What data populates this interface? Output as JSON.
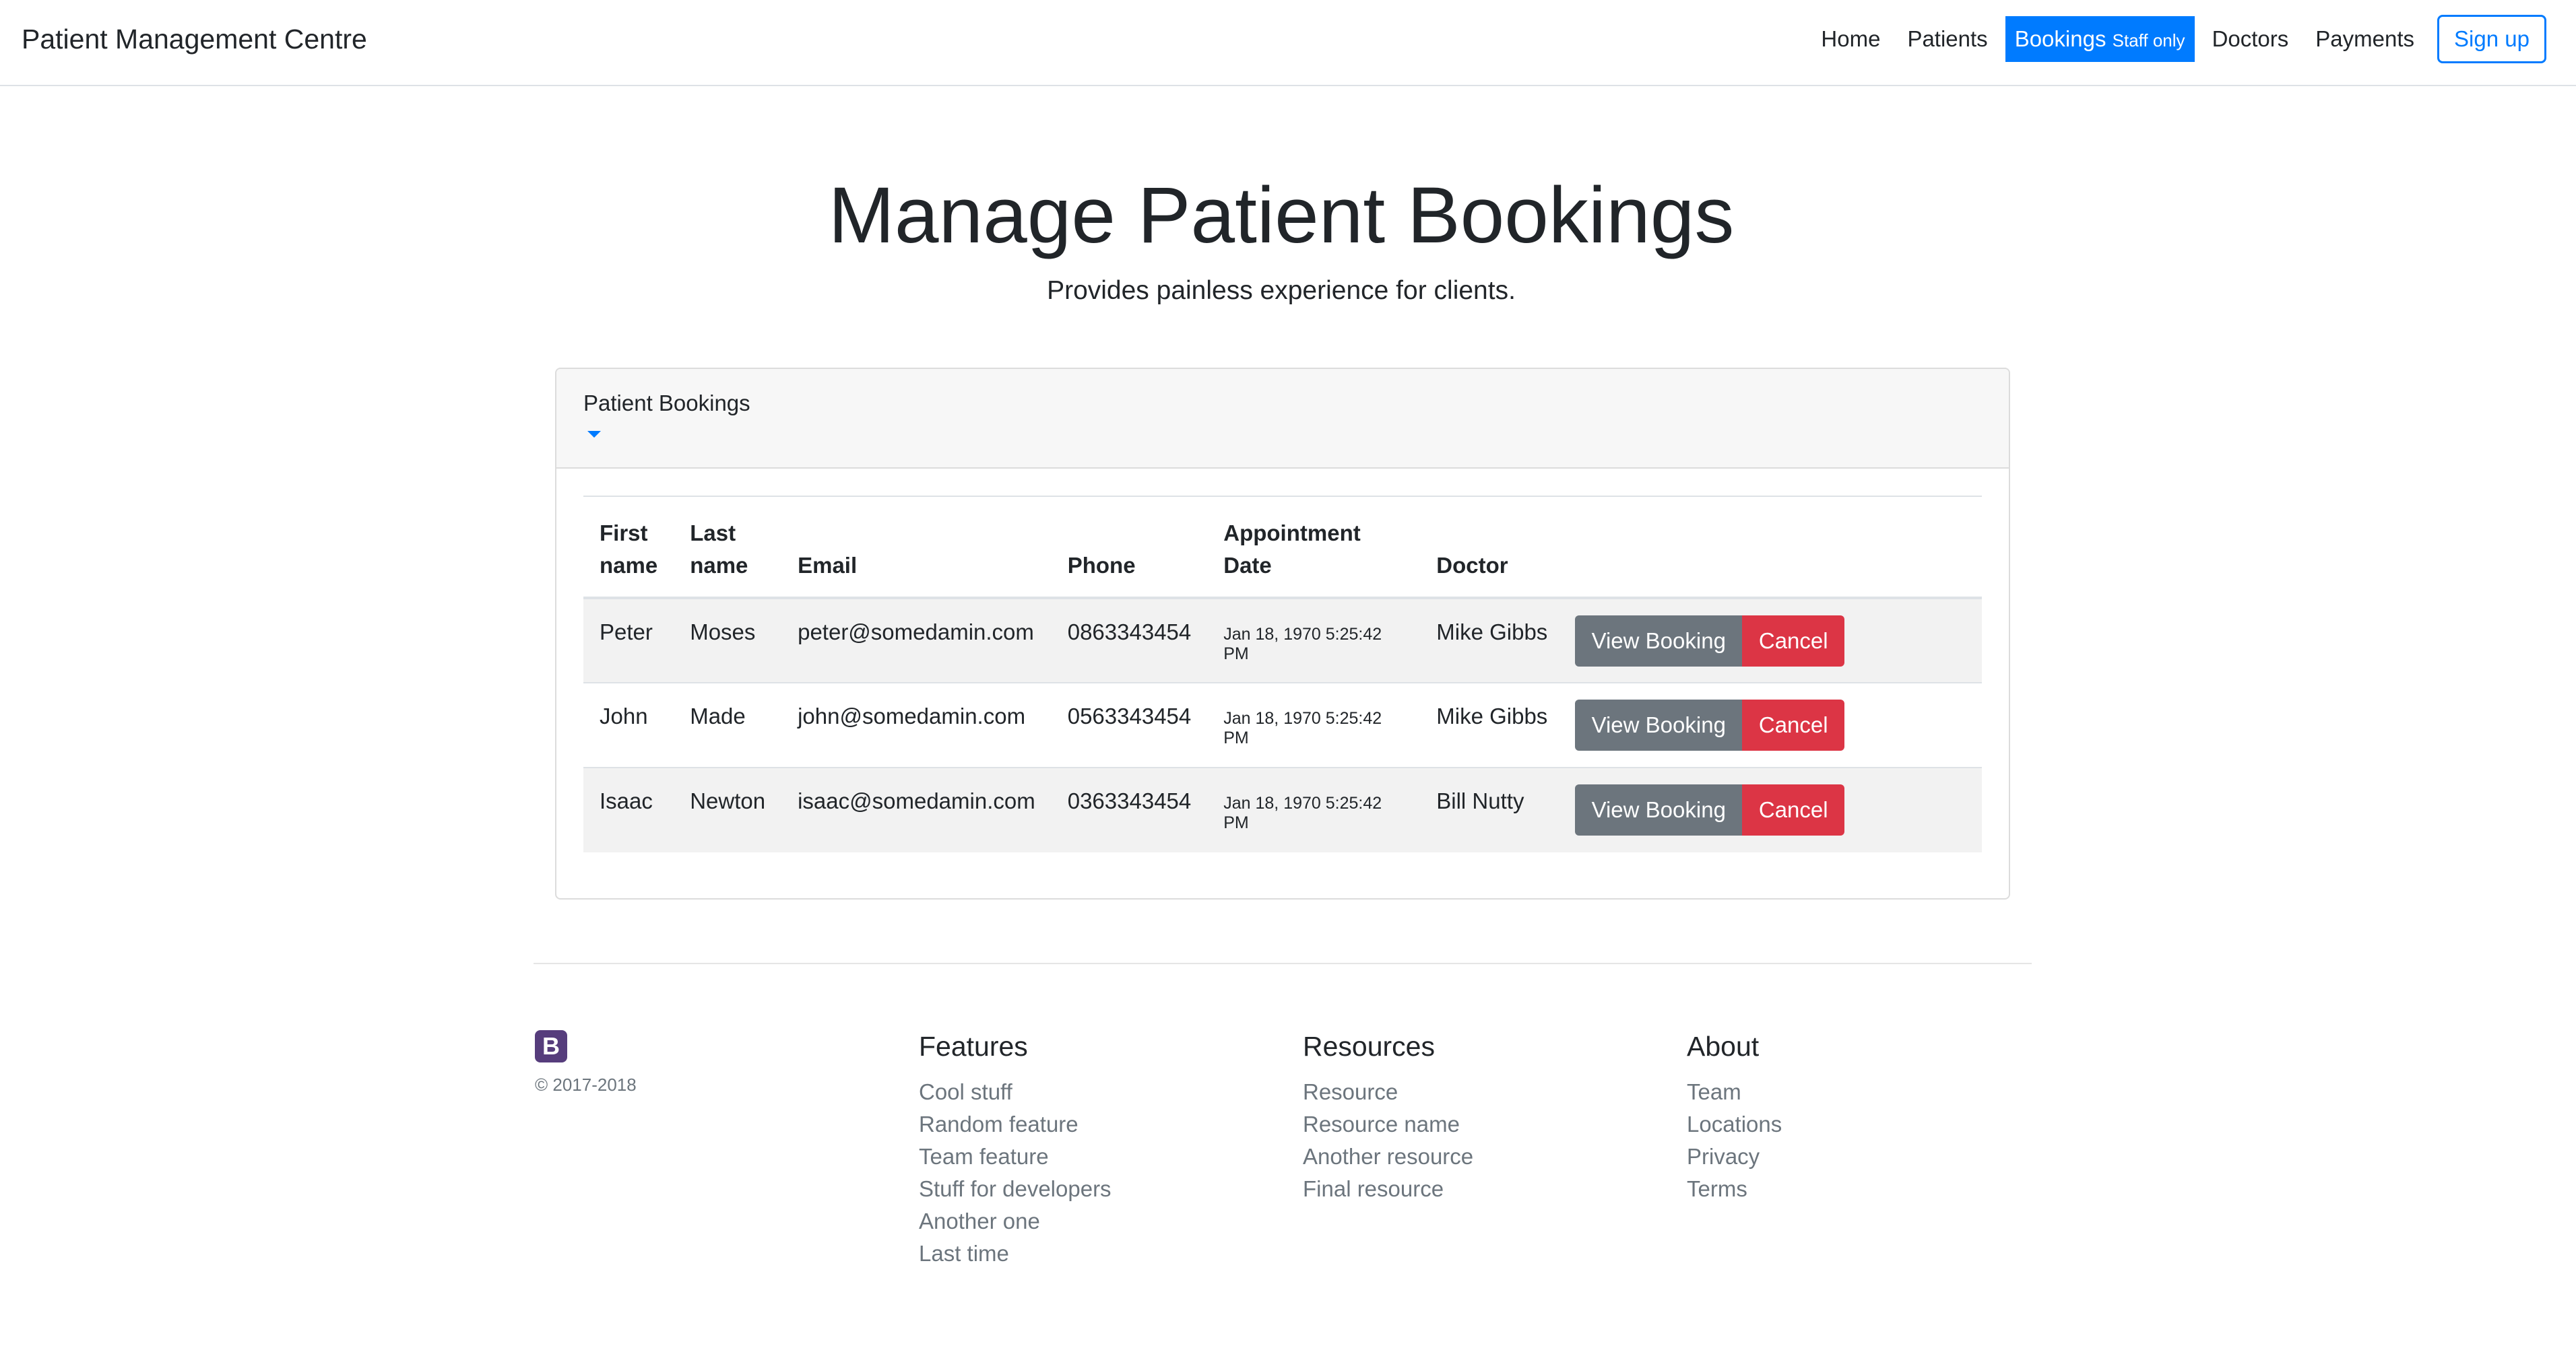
{
  "navbar": {
    "brand": "Patient Management Centre",
    "links": {
      "home": "Home",
      "patients": "Patients",
      "bookings": "Bookings",
      "bookings_badge": "Staff only",
      "doctors": "Doctors",
      "payments": "Payments"
    },
    "signup": "Sign up",
    "accent_color": "#007bff"
  },
  "hero": {
    "title": "Manage Patient Bookings",
    "subtitle": "Provides painless experience for clients."
  },
  "card": {
    "header": "Patient Bookings",
    "table": {
      "headers": {
        "first_name": "First name",
        "last_name": "Last name",
        "email": "Email",
        "phone": "Phone",
        "appointment_date": "Appointment Date",
        "doctor": "Doctor"
      },
      "rows": [
        {
          "first": "Peter",
          "last": "Moses",
          "email": "peter@somedamin.com",
          "phone": "0863343454",
          "date": "Jan 18, 1970 5:25:42 PM",
          "doctor": "Mike Gibbs",
          "view": "View Booking",
          "cancel": "Cancel"
        },
        {
          "first": "John",
          "last": "Made",
          "email": "john@somedamin.com",
          "phone": "0563343454",
          "date": "Jan 18, 1970 5:25:42 PM",
          "doctor": "Mike Gibbs",
          "view": "View Booking",
          "cancel": "Cancel"
        },
        {
          "first": "Isaac",
          "last": "Newton",
          "email": "isaac@somedamin.com",
          "phone": "0363343454",
          "date": "Jan 18, 1970 5:25:42 PM",
          "doctor": "Bill Nutty",
          "view": "View Booking",
          "cancel": "Cancel"
        }
      ]
    }
  },
  "footer": {
    "logo_letter": "B",
    "copyright": "© 2017-2018",
    "features": {
      "heading": "Features",
      "items": [
        "Cool stuff",
        "Random feature",
        "Team feature",
        "Stuff for developers",
        "Another one",
        "Last time"
      ]
    },
    "resources": {
      "heading": "Resources",
      "items": [
        "Resource",
        "Resource name",
        "Another resource",
        "Final resource"
      ]
    },
    "about": {
      "heading": "About",
      "items": [
        "Team",
        "Locations",
        "Privacy",
        "Terms"
      ]
    }
  }
}
